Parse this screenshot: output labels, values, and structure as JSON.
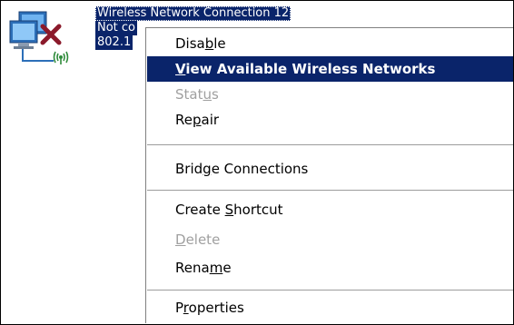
{
  "connection": {
    "line1": "Wireless Network Connection 12",
    "line2": "Not co",
    "line3": "802.1",
    "icon": "wireless-network-disconnected-icon"
  },
  "menu": {
    "items": [
      {
        "pre": "Disa",
        "key": "b",
        "post": "le",
        "state": "normal"
      },
      {
        "pre": "",
        "key": "V",
        "post": "iew Available Wireless Networks",
        "state": "selected"
      },
      {
        "pre": "Stat",
        "key": "u",
        "post": "s",
        "state": "disabled"
      },
      {
        "pre": "Re",
        "key": "p",
        "post": "air",
        "state": "normal"
      },
      {
        "pre": "Brid",
        "key": "g",
        "post": "e Connections",
        "state": "normal"
      },
      {
        "pre": "Create ",
        "key": "S",
        "post": "hortcut",
        "state": "normal"
      },
      {
        "pre": "",
        "key": "D",
        "post": "elete",
        "state": "disabled"
      },
      {
        "pre": "Rena",
        "key": "m",
        "post": "e",
        "state": "normal"
      },
      {
        "pre": "P",
        "key": "r",
        "post": "operties",
        "state": "normal"
      }
    ]
  },
  "colors": {
    "selection": "#0a246a",
    "disabled_text": "#a0a0a0",
    "error_x": "#8b1a2b"
  }
}
